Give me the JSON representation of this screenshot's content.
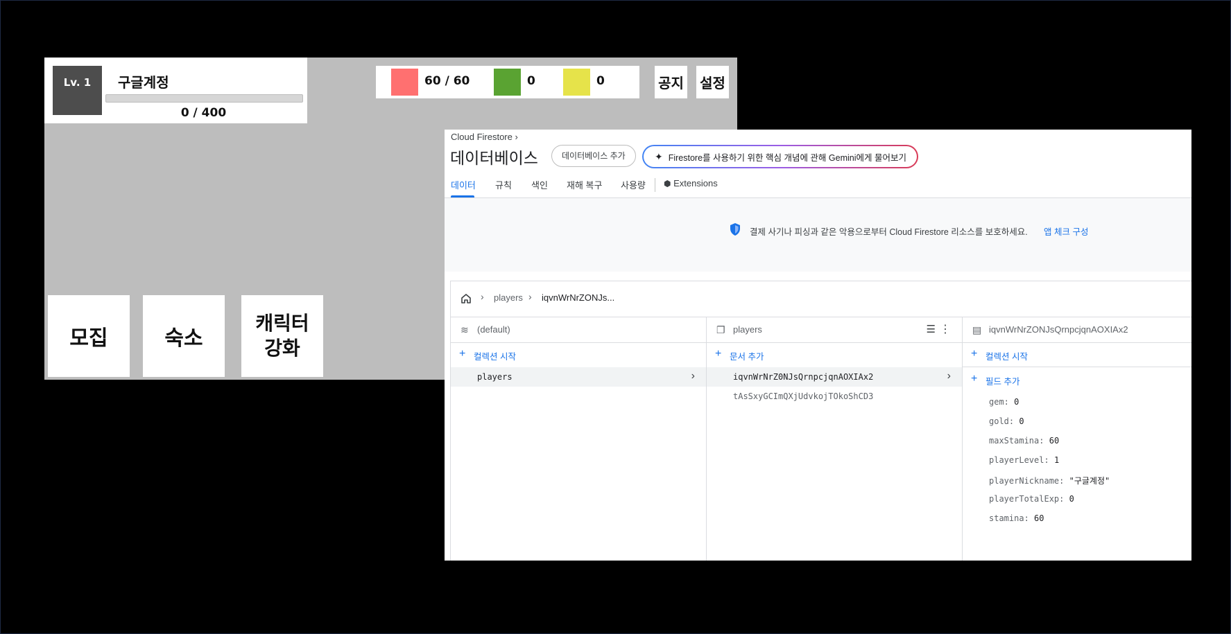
{
  "game": {
    "level_label": "Lv. 1",
    "nickname": "구글계정",
    "exp_text": "0 / 400",
    "exp_progress": 0,
    "resources": [
      {
        "color": "#ff7070",
        "value": "60 / 60"
      },
      {
        "color": "#5aa332",
        "value": "0"
      },
      {
        "color": "#e6e34a",
        "value": "0"
      }
    ],
    "notice_label": "공지",
    "settings_label": "설정",
    "menu": {
      "recruit_label": "모집",
      "dorm_label": "숙소",
      "upgrade_line1": "캐릭터",
      "upgrade_line2": "강화"
    }
  },
  "firestore": {
    "breadcrumb": "Cloud Firestore ›",
    "title": "데이터베이스",
    "add_db_label": "데이터베이스 추가",
    "gemini_label": "Firestore를 사용하기 위한 핵심 개념에 관해 Gemini에게 물어보기",
    "tabs": [
      "데이터",
      "규칙",
      "색인",
      "재해 복구",
      "사용량",
      "Extensions"
    ],
    "banner_text": "결제 사기나 피싱과 같은 악용으로부터 Cloud Firestore 리소스를 보호하세요.",
    "banner_link": "앱 체크 구성",
    "path": [
      "players",
      "iqvnWrNrZONJs..."
    ],
    "col1": {
      "header": "(default)",
      "add_label": "컬렉션 시작",
      "items": [
        "players"
      ]
    },
    "col2": {
      "header": "players",
      "add_label": "문서 추가",
      "items": [
        "iqvnWrNrZ0NJsQrnpcjqnAOXIAx2",
        "tAsSxyGCImQXjUdvkojTOkoShCD3"
      ]
    },
    "col3": {
      "header": "iqvnWrNrZONJsQrnpcjqnAOXIAx2",
      "add_collection_label": "컬렉션 시작",
      "add_field_label": "필드 추가",
      "fields": [
        {
          "key": "gem:",
          "value": "0"
        },
        {
          "key": "gold:",
          "value": "0"
        },
        {
          "key": "maxStamina:",
          "value": "60"
        },
        {
          "key": "playerLevel:",
          "value": "1"
        },
        {
          "key": "playerNickname:",
          "value": "\"구글계정\""
        },
        {
          "key": "playerTotalExp:",
          "value": "0"
        },
        {
          "key": "stamina:",
          "value": "60"
        }
      ]
    }
  }
}
